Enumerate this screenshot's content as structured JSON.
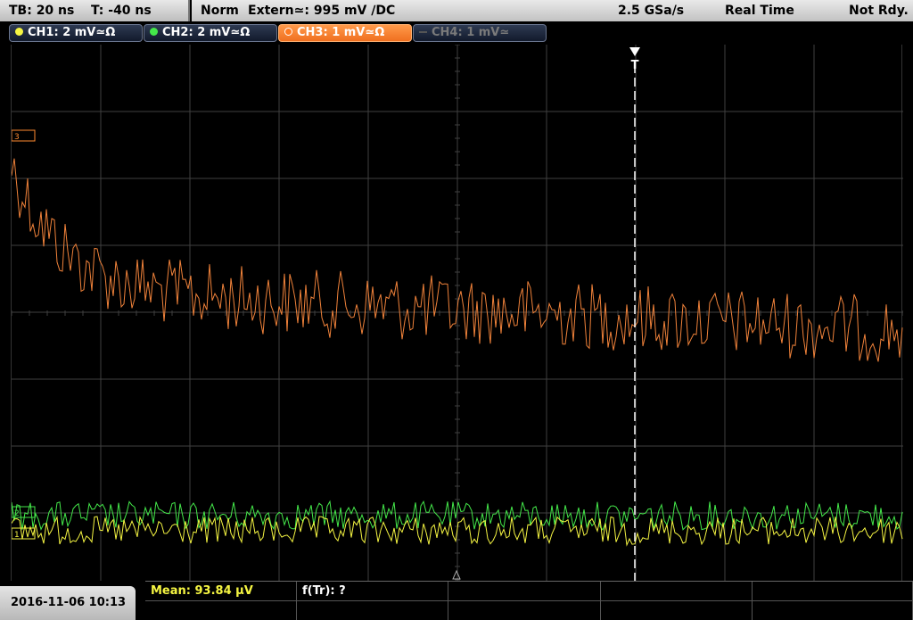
{
  "timebase": {
    "tb": "TB: 20 ns",
    "t": "T: -40 ns"
  },
  "trigger": {
    "mode": "Norm",
    "source": "Extern≃: 995 mV ∕DC",
    "sample_rate": "2.5 GSa/s",
    "acq_mode": "Real Time",
    "status": "Not Rdy."
  },
  "channels": [
    {
      "label": "CH1: 2 mV≃Ω",
      "color": "#f5f542",
      "active": false
    },
    {
      "label": "CH2: 2 mV≃Ω",
      "color": "#44e84a",
      "active": false
    },
    {
      "label": "CH3: 1 mV≃Ω",
      "color": "#ff8a30",
      "active": true
    },
    {
      "label": "CH4: 1 mV≃",
      "color": "#666666",
      "active": false
    }
  ],
  "trigger_marker": {
    "label": "T"
  },
  "footer": {
    "datetime": "2016-11-06 10:13",
    "measurements": [
      {
        "label": "Mean: 93.84 µV",
        "color": "#f5f542"
      },
      {
        "label": "f(Tr): ?",
        "color": "#ffffff"
      }
    ]
  },
  "colors": {
    "ch1": "#f5f542",
    "ch2": "#44e84a",
    "ch3": "#f0823a",
    "grid": "#404040"
  }
}
